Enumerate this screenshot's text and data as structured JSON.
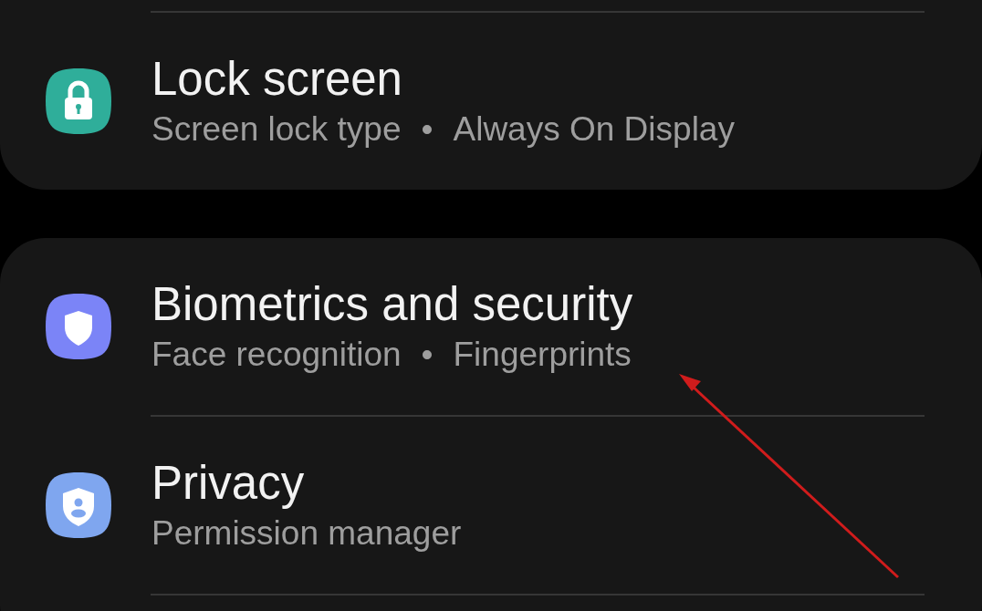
{
  "sections": [
    {
      "continues_above": true,
      "continues_below": false,
      "items": [
        {
          "kind": "lock",
          "color": "#2fae9a",
          "title": "Lock screen",
          "details": [
            "Screen lock type",
            "Always On Display"
          ]
        }
      ]
    },
    {
      "continues_above": false,
      "continues_below": true,
      "items": [
        {
          "kind": "shield",
          "color": "#7b84f7",
          "title": "Biometrics and security",
          "details": [
            "Face recognition",
            "Fingerprints"
          ]
        },
        {
          "kind": "shield-person",
          "color": "#7fa6ef",
          "title": "Privacy",
          "details": [
            "Permission manager"
          ]
        }
      ]
    }
  ],
  "separator": "•"
}
